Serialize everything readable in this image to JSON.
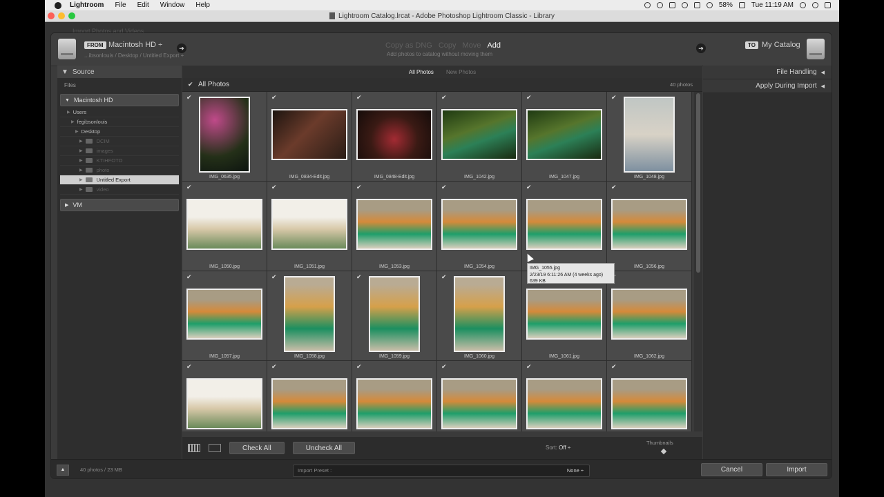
{
  "menubar": {
    "app": "Lightroom",
    "items": [
      "File",
      "Edit",
      "Window",
      "Help"
    ],
    "battery": "58%",
    "clock": "Tue 11:19 AM"
  },
  "window": {
    "title": "Lightroom Catalog.lrcat - Adobe Photoshop Lightroom Classic - Library"
  },
  "dialog": {
    "ghost_title": "Import Photos and Videos",
    "from_tag": "FROM",
    "from_source": "Macintosh HD ÷",
    "from_path": "...ibsonlouis / Desktop / Untitled Export +",
    "modes": [
      "Copy as DNG",
      "Copy",
      "Move",
      "Add"
    ],
    "mode_hint": "Add photos to catalog without moving them",
    "to_tag": "TO",
    "to_target": "My Catalog"
  },
  "source_panel": {
    "title": "Source",
    "files_label": "Files",
    "volume": "Macintosh HD",
    "tree": [
      {
        "label": "Users",
        "indent": 1,
        "style": "normal",
        "folder": false
      },
      {
        "label": "fegibsonlouis",
        "indent": 2,
        "style": "normal",
        "folder": false
      },
      {
        "label": "Desktop",
        "indent": 3,
        "style": "normal",
        "folder": false
      },
      {
        "label": "DCIM",
        "indent": 4,
        "style": "dim",
        "folder": true
      },
      {
        "label": "images",
        "indent": 4,
        "style": "dim",
        "folder": true
      },
      {
        "label": "KTIHFOTO",
        "indent": 4,
        "style": "dim",
        "folder": true
      },
      {
        "label": "photo",
        "indent": 4,
        "style": "dim",
        "folder": true
      },
      {
        "label": "Untitled Export",
        "indent": 4,
        "style": "sel",
        "folder": true
      },
      {
        "label": "video",
        "indent": 4,
        "style": "dim",
        "folder": true
      }
    ],
    "volume2": "VM"
  },
  "grid": {
    "tabs": [
      "All Photos",
      "New Photos"
    ],
    "header_label": "All Photos",
    "count": "40 photos",
    "photos": [
      {
        "name": "IMG_0635.jpg",
        "orient": "portrait",
        "tone": "p-pink"
      },
      {
        "name": "IMG_0834-Edit.jpg",
        "orient": "landscape",
        "tone": "p-dark"
      },
      {
        "name": "IMG_0848-Edit.jpg",
        "orient": "landscape",
        "tone": "p-red"
      },
      {
        "name": "IMG_1042.jpg",
        "orient": "landscape",
        "tone": "p-swing"
      },
      {
        "name": "IMG_1047.jpg",
        "orient": "landscape",
        "tone": "p-swing"
      },
      {
        "name": "IMG_1048.jpg",
        "orient": "portrait",
        "tone": "p-water"
      },
      {
        "name": "IMG_1050.jpg",
        "orient": "landscape",
        "tone": "p-beach"
      },
      {
        "name": "IMG_1051.jpg",
        "orient": "landscape",
        "tone": "p-beach"
      },
      {
        "name": "IMG_1053.jpg",
        "orient": "landscape",
        "tone": "p-group"
      },
      {
        "name": "IMG_1054.jpg",
        "orient": "landscape",
        "tone": "p-group"
      },
      {
        "name": "IMG_1055.jpg",
        "orient": "landscape",
        "tone": "p-group"
      },
      {
        "name": "IMG_1056.jpg",
        "orient": "landscape",
        "tone": "p-group"
      },
      {
        "name": "IMG_1057.jpg",
        "orient": "landscape",
        "tone": "p-group"
      },
      {
        "name": "IMG_1058.jpg",
        "orient": "portrait",
        "tone": "p-tall"
      },
      {
        "name": "IMG_1059.jpg",
        "orient": "portrait",
        "tone": "p-tall"
      },
      {
        "name": "IMG_1060.jpg",
        "orient": "portrait",
        "tone": "p-tall"
      },
      {
        "name": "IMG_1061.jpg",
        "orient": "landscape",
        "tone": "p-group"
      },
      {
        "name": "IMG_1062.jpg",
        "orient": "landscape",
        "tone": "p-group"
      },
      {
        "name": "",
        "orient": "landscape",
        "tone": "p-beach"
      },
      {
        "name": "",
        "orient": "landscape",
        "tone": "p-group"
      },
      {
        "name": "",
        "orient": "landscape",
        "tone": "p-group"
      },
      {
        "name": "",
        "orient": "landscape",
        "tone": "p-group"
      },
      {
        "name": "",
        "orient": "landscape",
        "tone": "p-group"
      },
      {
        "name": "",
        "orient": "landscape",
        "tone": "p-group"
      }
    ],
    "tooltip": {
      "line1": "IMG_1055.jpg",
      "line2": "2/23/19 6:11:26 AM (4 weeks ago)",
      "line3": "639 KB"
    },
    "check_all": "Check All",
    "uncheck_all": "Uncheck All",
    "sort_label": "Sort:",
    "sort_value": "Off ÷",
    "thumbnails_label": "Thumbnails"
  },
  "right_panel": {
    "sections": [
      "File Handling",
      "Apply During Import"
    ]
  },
  "footer": {
    "info": "40 photos / 23 MB",
    "preset_label": "Import Preset :",
    "preset_value": "None ÷",
    "cancel": "Cancel",
    "import": "Import"
  }
}
